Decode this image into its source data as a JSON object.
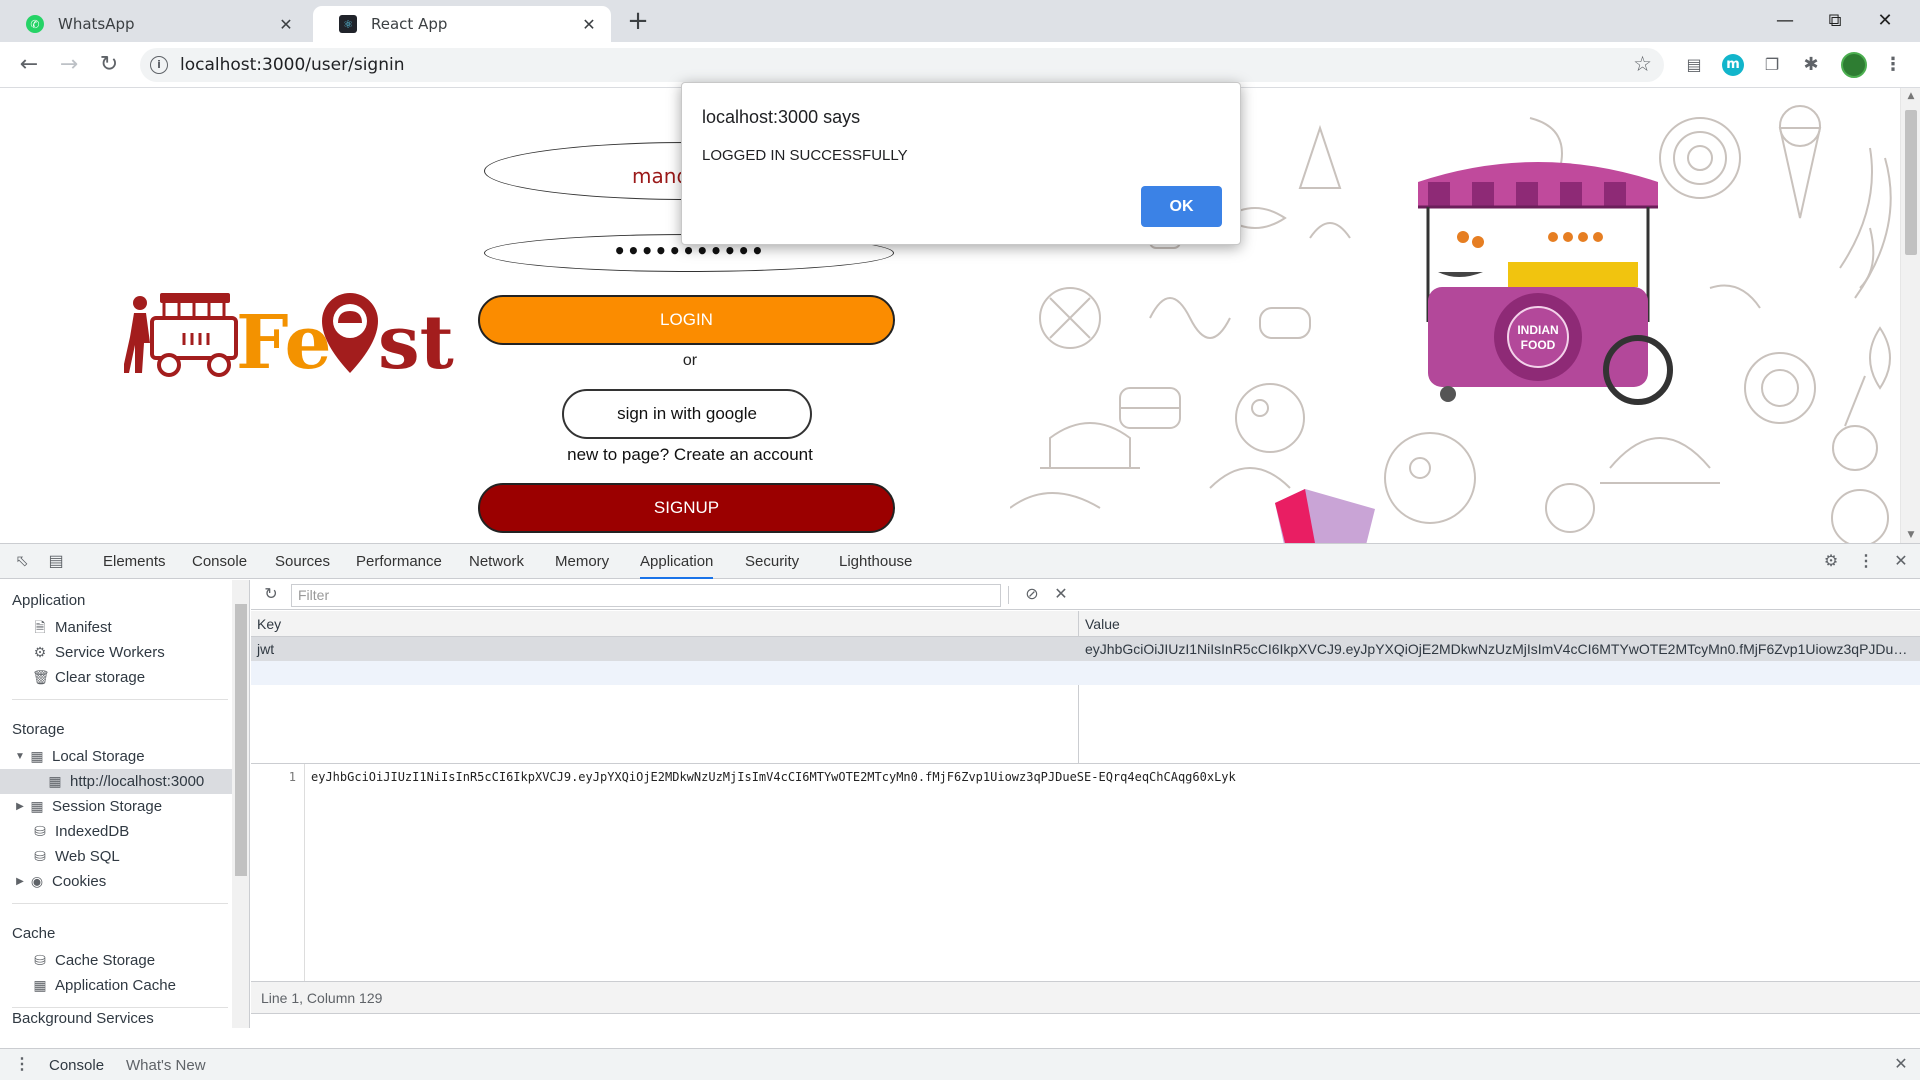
{
  "browser": {
    "tabs": [
      {
        "title": "WhatsApp",
        "active": false,
        "icon": "whatsapp-icon"
      },
      {
        "title": "React App",
        "active": true,
        "icon": "react-icon"
      }
    ],
    "url": "localhost:3000/user/signin"
  },
  "page": {
    "logo_text": "FeQst",
    "email_value": "mandya@g",
    "password_value": "•••••••••••",
    "login_label": "LOGIN",
    "or_text": "or",
    "google_label": "sign in with google",
    "create_account_text": "new to page? Create an account",
    "signup_label": "SIGNUP",
    "cart_sign": "INDIAN FOOD",
    "colors": {
      "login": "#fb8c00",
      "signup": "#9b0000",
      "logo_red": "#a31d1d",
      "logo_orange": "#f39200"
    }
  },
  "dialog": {
    "title": "localhost:3000 says",
    "message": "LOGGED IN SUCCESSFULLY",
    "ok_label": "OK"
  },
  "devtools": {
    "tabs": [
      "Elements",
      "Console",
      "Sources",
      "Performance",
      "Network",
      "Memory",
      "Application",
      "Security",
      "Lighthouse"
    ],
    "active_tab": "Application",
    "sidebar": {
      "application_header": "Application",
      "manifest": "Manifest",
      "service_workers": "Service Workers",
      "clear_storage": "Clear storage",
      "storage_header": "Storage",
      "local_storage": "Local Storage",
      "local_storage_origin": "http://localhost:3000",
      "session_storage": "Session Storage",
      "indexeddb": "IndexedDB",
      "web_sql": "Web SQL",
      "cookies": "Cookies",
      "cache_header": "Cache",
      "cache_storage": "Cache Storage",
      "application_cache": "Application Cache",
      "background_services_header": "Background Services"
    },
    "filter_placeholder": "Filter",
    "table": {
      "key_header": "Key",
      "value_header": "Value",
      "rows": [
        {
          "key": "jwt",
          "value": "eyJhbGciOiJIUzI1NiIsInR5cCI6IkpXVCJ9.eyJpYXQiOjE2MDkwNzUzMjIsImV4cCI6MTYwOTE2MTcyMn0.fMjF6Zvp1Uiowz3qPJDueSE-EQrq4eqChCAqg60xLyk"
        }
      ]
    },
    "preview": {
      "line_number": "1",
      "code": "eyJhbGciOiJIUzI1NiIsInR5cCI6IkpXVCJ9.eyJpYXQiOjE2MDkwNzUzMjIsImV4cCI6MTYwOTE2MTcyMn0.fMjF6Zvp1Uiowz3qPJDueSE-EQrq4eqChCAqg60xLyk"
    },
    "status_text": "Line 1, Column 129",
    "drawer": {
      "console_label": "Console",
      "whats_new_label": "What's New"
    }
  }
}
